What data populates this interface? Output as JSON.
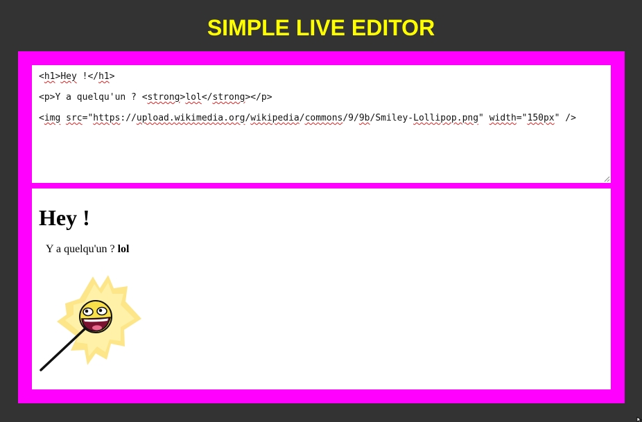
{
  "header": {
    "title": "SIMPLE LIVE EDITOR"
  },
  "editor": {
    "lines": [
      [
        {
          "t": "<",
          "s": false
        },
        {
          "t": "h1",
          "s": true
        },
        {
          "t": ">",
          "s": false
        },
        {
          "t": "Hey",
          "s": true
        },
        {
          "t": " !</",
          "s": false
        },
        {
          "t": "h1",
          "s": true
        },
        {
          "t": ">",
          "s": false
        }
      ],
      [
        {
          "t": "<p>Y a quelqu'un ? <",
          "s": false
        },
        {
          "t": "strong",
          "s": true
        },
        {
          "t": ">",
          "s": false
        },
        {
          "t": "lol",
          "s": true
        },
        {
          "t": "</",
          "s": false
        },
        {
          "t": "strong",
          "s": true
        },
        {
          "t": "></p>",
          "s": false
        }
      ],
      [
        {
          "t": "<",
          "s": false
        },
        {
          "t": "img",
          "s": true
        },
        {
          "t": " ",
          "s": false
        },
        {
          "t": "src",
          "s": true
        },
        {
          "t": "=\"",
          "s": false
        },
        {
          "t": "https",
          "s": true
        },
        {
          "t": "://",
          "s": false
        },
        {
          "t": "upload.wikimedia.org",
          "s": true
        },
        {
          "t": "/",
          "s": false
        },
        {
          "t": "wikipedia",
          "s": true
        },
        {
          "t": "/",
          "s": false
        },
        {
          "t": "commons",
          "s": true
        },
        {
          "t": "/9/",
          "s": false
        },
        {
          "t": "9b",
          "s": true
        },
        {
          "t": "/Smiley-",
          "s": false
        },
        {
          "t": "Lollipop.png",
          "s": true
        },
        {
          "t": "\" ",
          "s": false
        },
        {
          "t": "width",
          "s": true
        },
        {
          "t": "=\"",
          "s": false
        },
        {
          "t": "150px",
          "s": true
        },
        {
          "t": "\" />",
          "s": false
        }
      ]
    ]
  },
  "preview": {
    "heading": "Hey !",
    "paragraph_text": "Y a quelqu'un ?",
    "paragraph_strong": "lol",
    "image_icon": "smiley-lollipop-icon"
  },
  "colors": {
    "background": "#333333",
    "title": "#ffff00",
    "frame": "#ff00ff",
    "panel": "#ffffff",
    "spellcheck": "#e02020"
  }
}
